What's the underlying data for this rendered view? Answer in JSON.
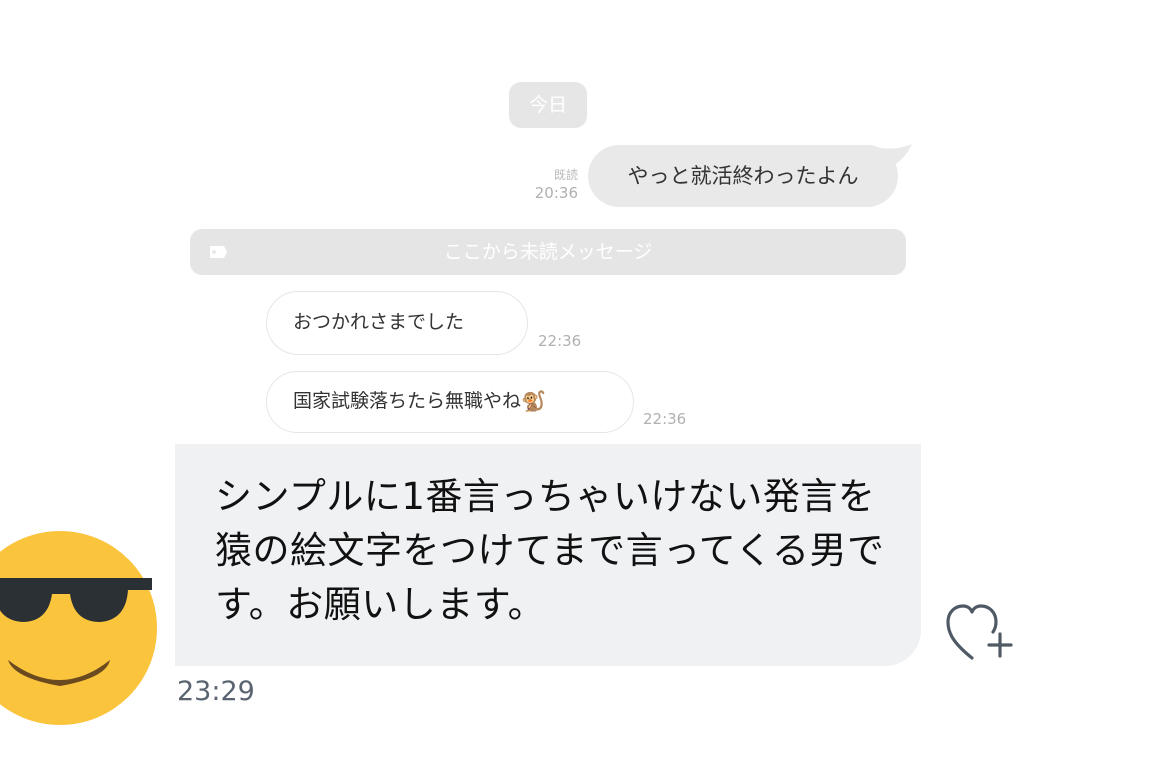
{
  "chat": {
    "date_label": "今日",
    "sent_message": {
      "read_label": "既読",
      "time": "20:36",
      "text": "やっと就活終わったよん"
    },
    "unread_divider": "ここから未読メッセージ",
    "received_messages": [
      {
        "text": "おつかれさまでした",
        "time": "22:36"
      },
      {
        "text": "国家試験落ちたら無職やね",
        "emoji": "🐒",
        "time": "22:36"
      }
    ]
  },
  "reply": {
    "text": "シンプルに1番言っちゃいけない発言を猿の絵文字をつけてまで言ってくる男です。お願いします。",
    "time": "23:29",
    "like_icon": "heart-plus-icon",
    "avatar_icon": "sunglasses-emoji-icon"
  },
  "colors": {
    "reply_bg": "#eff1f3",
    "pill_gray": "#e6e6e6",
    "emoji_yellow": "#fbc43d"
  }
}
